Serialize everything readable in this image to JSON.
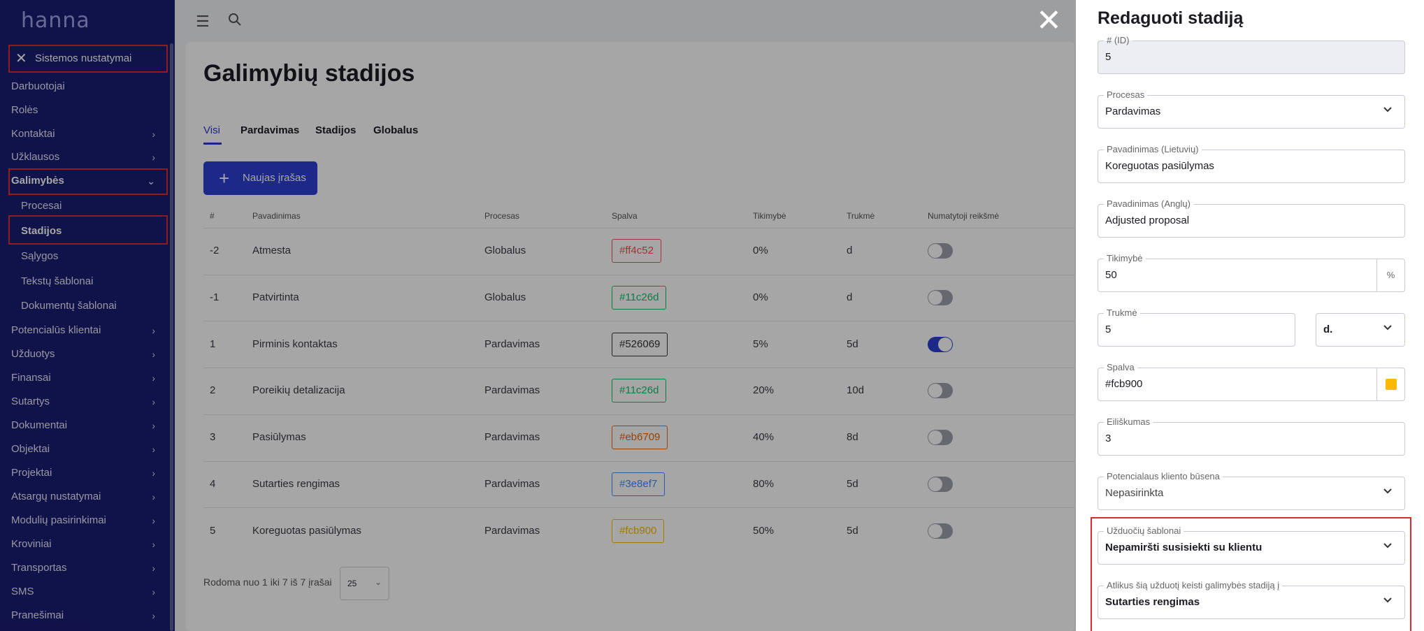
{
  "sidebar": {
    "logo": "hanna",
    "header": "Sistemos nustatymai",
    "items": [
      {
        "label": "Darbuotojai"
      },
      {
        "label": "Rolės"
      },
      {
        "label": "Kontaktai"
      },
      {
        "label": "Užklausos"
      },
      {
        "label": "Galimybės"
      },
      {
        "label": "Procesai"
      },
      {
        "label": "Stadijos"
      },
      {
        "label": "Sąlygos"
      },
      {
        "label": "Tekstų šablonai"
      },
      {
        "label": "Dokumentų šablonai"
      },
      {
        "label": "Potencialūs klientai"
      },
      {
        "label": "Užduotys"
      },
      {
        "label": "Finansai"
      },
      {
        "label": "Sutartys"
      },
      {
        "label": "Dokumentai"
      },
      {
        "label": "Objektai"
      },
      {
        "label": "Projektai"
      },
      {
        "label": "Atsargų nustatymai"
      },
      {
        "label": "Modulių pasirinkimai"
      },
      {
        "label": "Kroviniai"
      },
      {
        "label": "Transportas"
      },
      {
        "label": "SMS"
      },
      {
        "label": "Pranešimai"
      }
    ]
  },
  "main": {
    "title": "Galimybių stadijos",
    "tabs": [
      "Visi",
      "Pardavimas",
      "Stadijos",
      "Globalus"
    ],
    "new_button": "Naujas įrašas",
    "columns": [
      "#",
      "Pavadinimas",
      "Procesas",
      "Spalva",
      "Tikimybė",
      "Trukmė",
      "Numatytoji reikšmė"
    ],
    "rows": [
      {
        "id": "-2",
        "name": "Atmesta",
        "process": "Globalus",
        "color": "#ff4c52",
        "probability": "0%",
        "duration": "d",
        "default": false
      },
      {
        "id": "-1",
        "name": "Patvirtinta",
        "process": "Globalus",
        "color": "#11c26d",
        "probability": "0%",
        "duration": "d",
        "default": false
      },
      {
        "id": "1",
        "name": "Pirminis kontaktas",
        "process": "Pardavimas",
        "color": "#526069",
        "probability": "5%",
        "duration": "5d",
        "default": true
      },
      {
        "id": "2",
        "name": "Poreikių detalizacija",
        "process": "Pardavimas",
        "color": "#11c26d",
        "probability": "20%",
        "duration": "10d",
        "default": false
      },
      {
        "id": "3",
        "name": "Pasiūlymas",
        "process": "Pardavimas",
        "color": "#eb6709",
        "probability": "40%",
        "duration": "8d",
        "default": false
      },
      {
        "id": "4",
        "name": "Sutarties rengimas",
        "process": "Pardavimas",
        "color": "#3e8ef7",
        "probability": "80%",
        "duration": "5d",
        "default": false
      },
      {
        "id": "5",
        "name": "Koreguotas pasiūlymas",
        "process": "Pardavimas",
        "color": "#fcb900",
        "probability": "50%",
        "duration": "5d",
        "default": false
      }
    ],
    "pager_text": "Rodoma nuo 1 iki 7 iš 7 įrašai",
    "page_size": "25"
  },
  "drawer": {
    "title": "Redaguoti stadiją",
    "fields": {
      "id": {
        "label": "# (ID)",
        "value": "5"
      },
      "process": {
        "label": "Procesas",
        "value": "Pardavimas"
      },
      "name_lt": {
        "label": "Pavadinimas (Lietuvių)",
        "value": "Koreguotas pasiūlymas"
      },
      "name_en": {
        "label": "Pavadinimas (Anglų)",
        "value": "Adjusted proposal"
      },
      "probability": {
        "label": "Tikimybė",
        "value": "50",
        "suffix": "%"
      },
      "duration": {
        "label": "Trukmė",
        "value": "5",
        "unit": "d."
      },
      "color": {
        "label": "Spalva",
        "value": "#fcb900"
      },
      "order": {
        "label": "Eiliškumas",
        "value": "3"
      },
      "lead_status": {
        "label": "Potencialaus kliento būsena",
        "value": "Nepasirinkta"
      },
      "task_templates": {
        "label": "Užduočių šablonai",
        "value": "Nepamiršti susisiekti su klientu"
      },
      "after_task_stage": {
        "label": "Atlikus šią užduotį keisti galimybės stadiją į",
        "value": "Sutarties rengimas"
      }
    }
  },
  "colors": {
    "sidebar_bg": "#1a1c72",
    "accent": "#2d3fd2",
    "highlight": "#e02a2a"
  }
}
